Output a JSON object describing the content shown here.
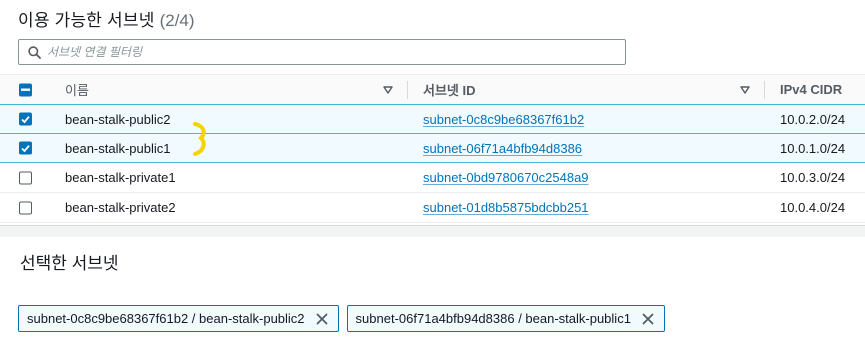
{
  "header": {
    "title": "이용 가능한 서브넷",
    "count": "(2/4)"
  },
  "filter": {
    "placeholder": "서브넷 연결 필터링",
    "value": ""
  },
  "table": {
    "columns": {
      "name": "이름",
      "subnet_id": "서브넷 ID",
      "cidr": "IPv4 CIDR"
    },
    "rows": [
      {
        "name": "bean-stalk-public2",
        "subnet_id": "subnet-0c8c9be68367f61b2",
        "cidr": "10.0.2.0/24",
        "selected": true
      },
      {
        "name": "bean-stalk-public1",
        "subnet_id": "subnet-06f71a4bfb94d8386",
        "cidr": "10.0.1.0/24",
        "selected": true
      },
      {
        "name": "bean-stalk-private1",
        "subnet_id": "subnet-0bd9780670c2548a9",
        "cidr": "10.0.3.0/24",
        "selected": false
      },
      {
        "name": "bean-stalk-private2",
        "subnet_id": "subnet-01d8b5875bdcbb251",
        "cidr": "10.0.4.0/24",
        "selected": false
      }
    ]
  },
  "selected_section": {
    "title": "선택한 서브넷",
    "tokens": [
      {
        "label": "subnet-0c8c9be68367f61b2 / bean-stalk-public2"
      },
      {
        "label": "subnet-06f71a4bfb94d8386 / bean-stalk-public1"
      }
    ]
  },
  "colors": {
    "accent": "#0073bb",
    "highlight_mark": "#f5d400",
    "selected_row": "#f1faff"
  },
  "icons": {
    "search": "search-icon",
    "sort": "caret-down-icon",
    "remove": "close-icon"
  }
}
